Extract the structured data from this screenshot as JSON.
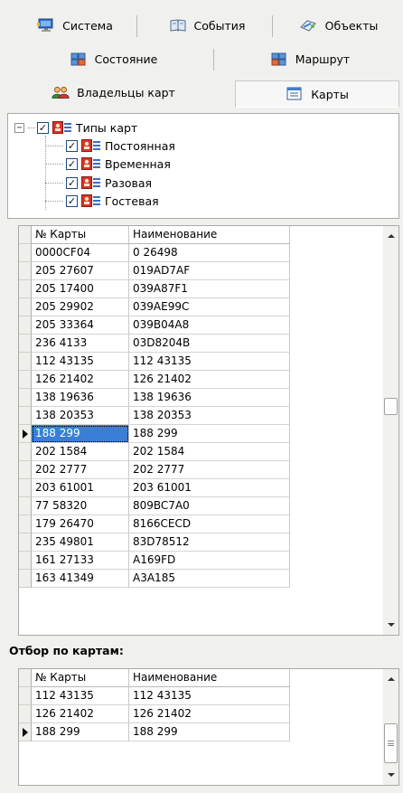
{
  "tabs": {
    "row1": [
      {
        "label": "Система",
        "icon": "monitor-icon"
      },
      {
        "label": "События",
        "icon": "book-icon"
      },
      {
        "label": "Объекты",
        "icon": "objects-icon"
      }
    ],
    "row2": [
      {
        "label": "Состояние",
        "icon": "state-icon"
      },
      {
        "label": "Маршрут",
        "icon": "route-icon"
      }
    ],
    "row3": [
      {
        "label": "Владельцы карт",
        "icon": "users-icon"
      },
      {
        "label": "Карты",
        "icon": "cards-icon",
        "active": true
      }
    ]
  },
  "tree": {
    "root": "Типы карт",
    "root_expander": "−",
    "check": "✓",
    "children": [
      "Постоянная",
      "Временная",
      "Разовая",
      "Гостевая"
    ]
  },
  "cards_grid": {
    "columns": [
      "№ Карты",
      "Наименование"
    ],
    "rows": [
      [
        "0000CF04",
        "0 26498"
      ],
      [
        "205 27607",
        "019AD7AF"
      ],
      [
        "205 17400",
        "039A87F1"
      ],
      [
        "205 29902",
        "039AE99C"
      ],
      [
        "205 33364",
        "039B04A8"
      ],
      [
        "236 4133",
        "03D8204B"
      ],
      [
        "112 43135",
        "112 43135"
      ],
      [
        "126 21402",
        "126 21402"
      ],
      [
        "138 19636",
        "138 19636"
      ],
      [
        "138 20353",
        "138 20353"
      ],
      [
        "188 299",
        "188 299"
      ],
      [
        "202 1584",
        "202 1584"
      ],
      [
        "202 2777",
        "202 2777"
      ],
      [
        "203 61001",
        "203 61001"
      ],
      [
        "77 58320",
        "809BC7A0"
      ],
      [
        "179 26470",
        "8166CECD"
      ],
      [
        "235 49801",
        "83D78512"
      ],
      [
        "161 27133",
        "A169FD"
      ],
      [
        "163 41349",
        "A3A185"
      ]
    ],
    "current_row": 10
  },
  "filter": {
    "title": "Отбор по картам:",
    "columns": [
      "№ Карты",
      "Наименование"
    ],
    "rows": [
      [
        "112 43135",
        "112 43135"
      ],
      [
        "126 21402",
        "126 21402"
      ],
      [
        "188 299",
        "188 299"
      ]
    ],
    "current_row": 2
  },
  "colors": {
    "selection": "#3a7ed8",
    "panel": "#f0f0ee"
  }
}
